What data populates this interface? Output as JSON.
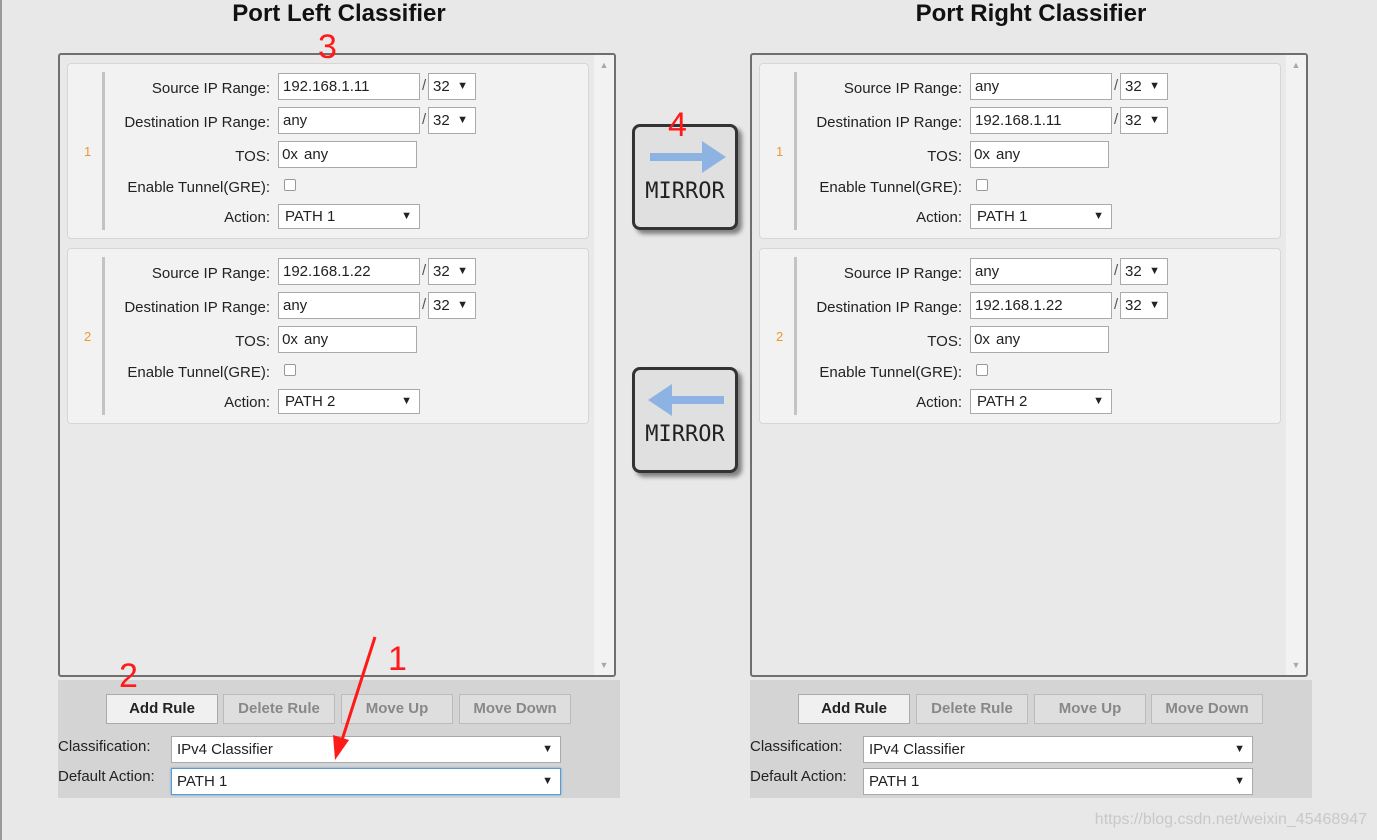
{
  "left": {
    "title": "Port Left Classifier",
    "rules": [
      {
        "num": "1",
        "source_label": "Source IP Range:",
        "source_ip": "192.168.1.11",
        "source_mask": "32",
        "dest_label": "Destination IP Range:",
        "dest_ip": "any",
        "dest_mask": "32",
        "tos_label": "TOS:",
        "tos_prefix": "0x",
        "tos": "any",
        "tunnel_label": "Enable Tunnel(GRE):",
        "tunnel_checked": false,
        "action_label": "Action:",
        "action": "PATH 1"
      },
      {
        "num": "2",
        "source_label": "Source IP Range:",
        "source_ip": "192.168.1.22",
        "source_mask": "32",
        "dest_label": "Destination IP Range:",
        "dest_ip": "any",
        "dest_mask": "32",
        "tos_label": "TOS:",
        "tos_prefix": "0x",
        "tos": "any",
        "tunnel_label": "Enable Tunnel(GRE):",
        "tunnel_checked": false,
        "action_label": "Action:",
        "action": "PATH 2"
      }
    ],
    "buttons": {
      "add": "Add Rule",
      "delete": "Delete Rule",
      "up": "Move Up",
      "down": "Move Down"
    },
    "classification_label": "Classification:",
    "classification": "IPv4 Classifier",
    "default_action_label": "Default Action:",
    "default_action": "PATH 1"
  },
  "right": {
    "title": "Port Right Classifier",
    "rules": [
      {
        "num": "1",
        "source_label": "Source IP Range:",
        "source_ip": "any",
        "source_mask": "32",
        "dest_label": "Destination IP Range:",
        "dest_ip": "192.168.1.11",
        "dest_mask": "32",
        "tos_label": "TOS:",
        "tos_prefix": "0x",
        "tos": "any",
        "tunnel_label": "Enable Tunnel(GRE):",
        "tunnel_checked": false,
        "action_label": "Action:",
        "action": "PATH 1"
      },
      {
        "num": "2",
        "source_label": "Source IP Range:",
        "source_ip": "any",
        "source_mask": "32",
        "dest_label": "Destination IP Range:",
        "dest_ip": "192.168.1.22",
        "dest_mask": "32",
        "tos_label": "TOS:",
        "tos_prefix": "0x",
        "tos": "any",
        "tunnel_label": "Enable Tunnel(GRE):",
        "tunnel_checked": false,
        "action_label": "Action:",
        "action": "PATH 2"
      }
    ],
    "buttons": {
      "add": "Add Rule",
      "delete": "Delete Rule",
      "up": "Move Up",
      "down": "Move Down"
    },
    "classification_label": "Classification:",
    "classification": "IPv4 Classifier",
    "default_action_label": "Default Action:",
    "default_action": "PATH 1"
  },
  "mirror": {
    "to_right_label": "MIRROR",
    "to_left_label": "MIRROR",
    "arrow_color": "#8db3e2"
  },
  "annotations": {
    "a1": "1",
    "a2": "2",
    "a3": "3",
    "a4": "4",
    "color": "#ff1a1a"
  },
  "watermark": "https://blog.csdn.net/weixin_45468947"
}
